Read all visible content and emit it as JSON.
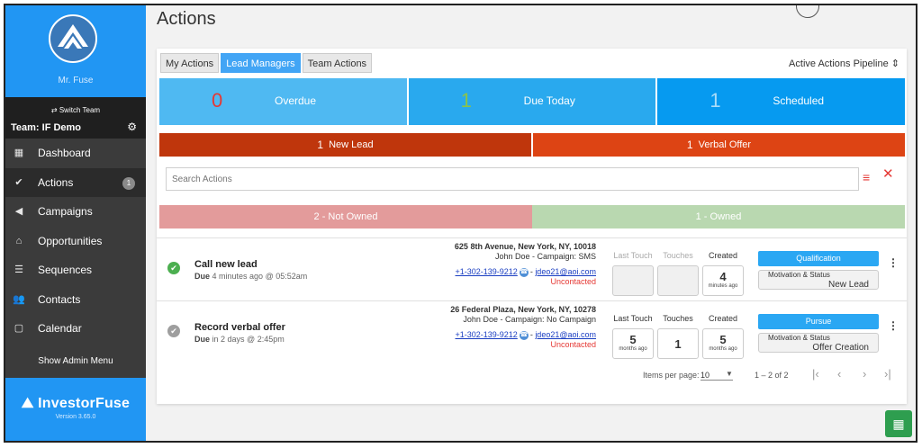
{
  "sidebar": {
    "user_name": "Mr. Fuse",
    "switch_team": "⇄ Switch Team",
    "team_name": "Team: IF Demo",
    "items": [
      {
        "label": "Dashboard",
        "icon": "dashboard-icon"
      },
      {
        "label": "Actions",
        "icon": "check-circle-icon",
        "badge": "1"
      },
      {
        "label": "Campaigns",
        "icon": "megaphone-icon"
      },
      {
        "label": "Opportunities",
        "icon": "home-icon"
      },
      {
        "label": "Sequences",
        "icon": "sequence-icon"
      },
      {
        "label": "Contacts",
        "icon": "people-icon"
      },
      {
        "label": "Calendar",
        "icon": "calendar-icon"
      }
    ],
    "show_admin": "Show Admin Menu",
    "brand": "InvestorFuse",
    "version": "Version 3.65.0"
  },
  "header": {
    "title": "Actions"
  },
  "tabs": [
    "My Actions",
    "Lead Managers",
    "Team Actions"
  ],
  "pipeline": {
    "label": "Active Actions Pipeline"
  },
  "stats": [
    {
      "value": "0",
      "label": "Overdue",
      "bg": "#4fb9f2",
      "num_color": "#e53935"
    },
    {
      "value": "1",
      "label": "Due Today",
      "bg": "#29a9ee",
      "num_color": "#8bc34a"
    },
    {
      "value": "1",
      "label": "Scheduled",
      "bg": "#069af0",
      "num_color": "#a9dcf9"
    }
  ],
  "pills": [
    {
      "value": "1",
      "label": "New Lead",
      "bg": "#bf360c"
    },
    {
      "value": "1",
      "label": "Verbal Offer",
      "bg": "#dd4414"
    }
  ],
  "search": {
    "placeholder": "Search Actions"
  },
  "ownership": [
    {
      "label": "2 - Not Owned",
      "bg": "#e39b9b"
    },
    {
      "label": "1 - Owned",
      "bg": "#b9d8b0"
    }
  ],
  "metric_headers": {
    "last_touch": "Last Touch",
    "touches": "Touches",
    "created": "Created"
  },
  "rows": [
    {
      "title": "Call new lead",
      "due_prefix": "Due",
      "due_text": "4 minutes ago @ 05:52am",
      "status_color": "#4caf50",
      "street": "625 8th Avenue, New York, NY, 10018",
      "owner_campaign": "John Doe - Campaign: SMS",
      "phone": "+1-302-139-9212",
      "email": "jdeo21@aoi.com",
      "contact_status": "Uncontacted",
      "last_touch": null,
      "touches": null,
      "created": {
        "value": "4",
        "unit": "minutes ago"
      },
      "stage": "Qualification",
      "motivation_label": "Motivation & Status",
      "motivation_value": "New Lead"
    },
    {
      "title": "Record verbal offer",
      "due_prefix": "Due",
      "due_text": "in 2 days @ 2:45pm",
      "status_color": "#9e9e9e",
      "street": "26 Federal Plaza, New York, NY, 10278",
      "owner_campaign": "John Doe - Campaign: No Campaign",
      "phone": "+1-302-139-9212",
      "email": "jdeo21@aoi.com",
      "contact_status": "Uncontacted",
      "last_touch": {
        "value": "5",
        "unit": "months ago"
      },
      "touches": {
        "value": "1"
      },
      "created": {
        "value": "5",
        "unit": "months ago"
      },
      "stage": "Pursue",
      "motivation_label": "Motivation & Status",
      "motivation_value": "Offer Creation"
    }
  ],
  "paginator": {
    "items_per_page_label": "Items per page:",
    "items_per_page": "10",
    "range": "1 – 2 of 2"
  }
}
